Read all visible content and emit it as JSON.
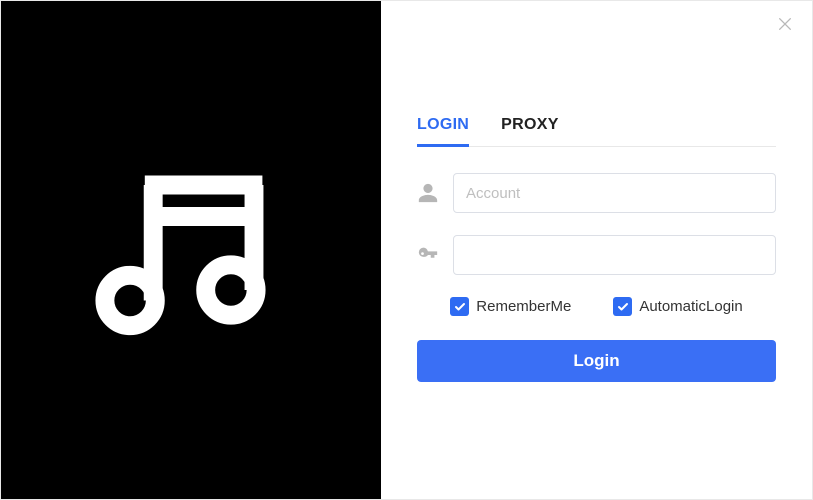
{
  "tabs": {
    "login": "LOGIN",
    "proxy": "PROXY"
  },
  "fields": {
    "account_placeholder": "Account",
    "account_value": "",
    "password_value": ""
  },
  "checks": {
    "remember_label": "RememberMe",
    "remember_checked": true,
    "auto_label": "AutomaticLogin",
    "auto_checked": true
  },
  "buttons": {
    "login": "Login"
  }
}
